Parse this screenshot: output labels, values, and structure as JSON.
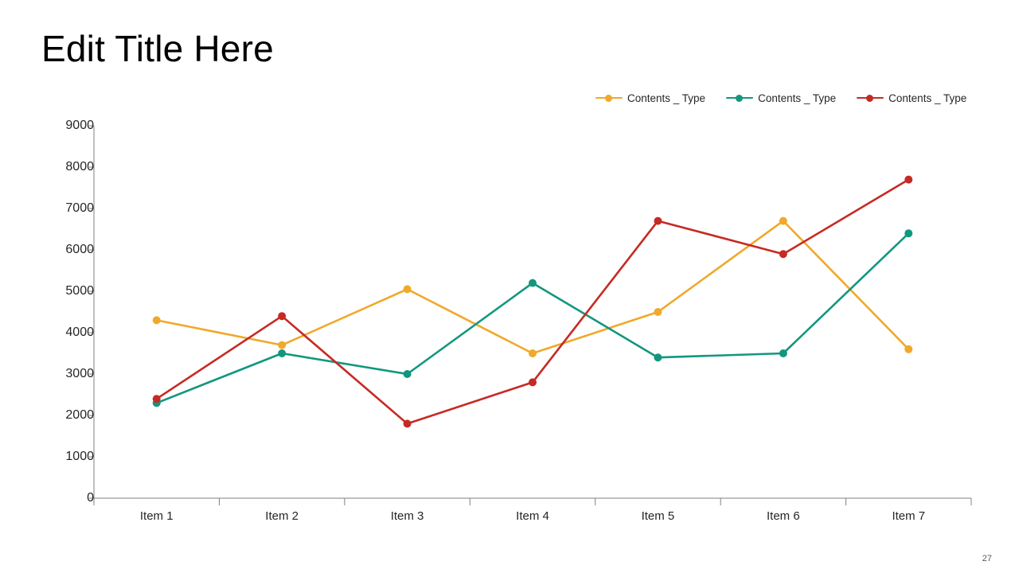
{
  "slide": {
    "title": "Edit Title Here",
    "page_number": "27"
  },
  "legend": {
    "position": "top-right",
    "items": [
      {
        "label": "Contents _ Type",
        "color": "#F0A92B"
      },
      {
        "label": "Contents _ Type",
        "color": "#12977E"
      },
      {
        "label": "Contents _ Type",
        "color": "#C62A24"
      }
    ]
  },
  "chart_data": {
    "type": "line",
    "title": "",
    "xlabel": "",
    "ylabel": "",
    "categories": [
      "Item 1",
      "Item 2",
      "Item 3",
      "Item 4",
      "Item 5",
      "Item 6",
      "Item 7"
    ],
    "series": [
      {
        "name": "Contents _ Type",
        "color": "#F0A92B",
        "values": [
          4300,
          3700,
          5050,
          3500,
          4500,
          6700,
          3600
        ]
      },
      {
        "name": "Contents _ Type",
        "color": "#12977E",
        "values": [
          2300,
          3500,
          3000,
          5200,
          3400,
          3500,
          6400
        ]
      },
      {
        "name": "Contents _ Type",
        "color": "#C62A24",
        "values": [
          2400,
          4400,
          1800,
          2800,
          6700,
          5900,
          7700
        ]
      }
    ],
    "ylim": [
      0,
      9000
    ],
    "yticks": [
      0,
      1000,
      2000,
      3000,
      4000,
      5000,
      6000,
      7000,
      8000,
      9000
    ],
    "ytick_labels": [
      "0",
      "1000",
      "2000",
      "3000",
      "4000",
      "5000",
      "6000",
      "7000",
      "8000",
      "9000"
    ],
    "grid": false,
    "markers": true,
    "legend_position": "top-right",
    "axis_color": "#808080"
  }
}
